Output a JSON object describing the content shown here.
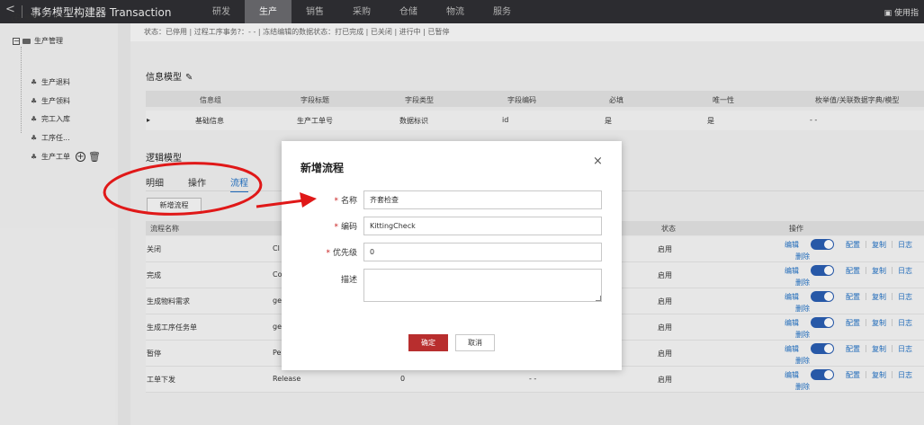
{
  "app": {
    "back_glyph": "<",
    "title": "事务模型构建器 Transaction",
    "nav": [
      "研发",
      "生产",
      "销售",
      "采购",
      "仓储",
      "物流",
      "服务"
    ],
    "active_nav": 1,
    "guide": "使用指"
  },
  "sidebar": {
    "add_scene": "新增业务场景",
    "root": "生产管理",
    "items": [
      "生产退料",
      "生产领料",
      "完工入库",
      "工序任...",
      "生产工单"
    ]
  },
  "status_line": "状态：已停用  |  过程工序事务?：- -  |  冻结编辑的数据状态：打已完成 | 已关闭 | 进行中 | 已暂停",
  "info_model": {
    "title": "信息模型",
    "columns": [
      "信息组",
      "字段标题",
      "字段类型",
      "字段编码",
      "必填",
      "唯一性",
      "枚举值/关联数据字典/模型"
    ],
    "rows": [
      {
        "group": "基础信息",
        "field_title": "生产工单号",
        "field_type": "数据标识",
        "field_code": "id",
        "required": "是",
        "unique": "是",
        "enum": "- -"
      }
    ]
  },
  "logic_model": {
    "title": "逻辑模型",
    "tabs": [
      "明细",
      "操作",
      "流程"
    ],
    "active_tab": 2,
    "add_flow_button": "新增流程",
    "flow_columns": [
      "流程名称",
      "状态",
      "操作"
    ],
    "flows": [
      {
        "name": "关闭",
        "code": "Cl",
        "priority": "",
        "desc": "",
        "status": "启用"
      },
      {
        "name": "完成",
        "code": "Co",
        "priority": "",
        "desc": "",
        "status": "启用"
      },
      {
        "name": "生成物料需求",
        "code": "ge",
        "priority": "",
        "desc": "",
        "status": "启用"
      },
      {
        "name": "生成工序任务单",
        "code": "ge",
        "priority": "",
        "desc": "",
        "status": "启用"
      },
      {
        "name": "暂停",
        "code": "Pe",
        "priority": "",
        "desc": "",
        "status": "启用"
      },
      {
        "name": "工单下发",
        "code": "Release",
        "priority": "0",
        "desc": "- -",
        "status": "启用"
      }
    ],
    "ops": {
      "edit": "编辑",
      "config": "配置",
      "copy": "复制",
      "log": "日志",
      "delete": "删除"
    }
  },
  "modal": {
    "title": "新增流程",
    "close_glyph": "×",
    "fields": {
      "name_label": "名称",
      "name_value": "齐套检查",
      "code_label": "编码",
      "code_value": "KittingCheck",
      "priority_label": "优先级",
      "priority_value": "0",
      "desc_label": "描述"
    },
    "ok_button": "确定",
    "cancel_button": "取消"
  },
  "colors": {
    "topbar": "#2f2f33",
    "accent_blue": "#1f6fc3",
    "primary_red": "#b82e2e",
    "annotation_red": "#e01818"
  }
}
